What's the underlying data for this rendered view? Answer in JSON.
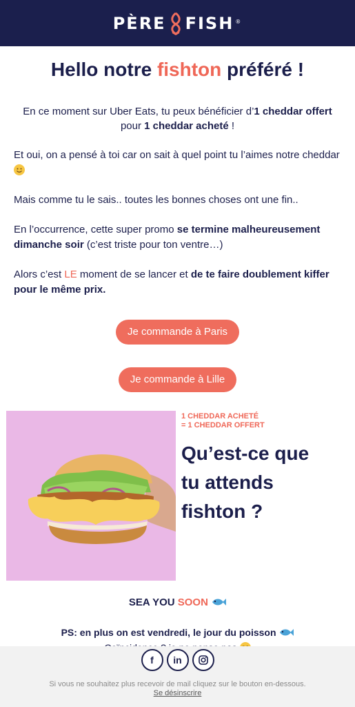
{
  "header": {
    "logo_left": "PÈRE",
    "logo_right": "FISH",
    "logo_mark": "®"
  },
  "title": {
    "before": "Hello notre ",
    "accent": "fishton",
    "after": " préféré !"
  },
  "intro": {
    "t1": "En ce moment sur Uber Eats, tu peux bénéficier d’",
    "b1": "1 cheddar offert",
    "t2": " pour ",
    "b2": "1 cheddar acheté",
    "t3": " !"
  },
  "p1": {
    "text": "Et oui, on a pensé à toi car on sait à quel point tu l’aimes notre cheddar",
    "emoji": "smiling-face-icon"
  },
  "p2": {
    "text": "Mais comme tu le sais.. toutes les bonnes choses ont une fin.."
  },
  "p3": {
    "t1": "En l’occurrence, cette super promo ",
    "b1": "se termine malheureusement dimanche soir",
    "t2": " (c’est triste pour ton ventre…)"
  },
  "p4": {
    "t1": "Alors c’est ",
    "red": "LE",
    "t2": " moment de se lancer et ",
    "b1": "de te faire doublement kiffer pour le même prix."
  },
  "buttons": {
    "paris": "Je commande à Paris",
    "lille": "Je commande à Lille"
  },
  "promo": {
    "deal_line1": "1 CHEDDAR ACHETÉ",
    "deal_line2": "= 1 CHEDDAR OFFERT",
    "headline": [
      "Qu’est-ce que",
      "tu attends",
      "fishton ?"
    ]
  },
  "sea": {
    "t1": "SEA YOU ",
    "red": "SOON"
  },
  "ps": {
    "b1": "PS: en plus on est vendredi, le jour du poisson",
    "t2": "Coïncidence ? je ne pense pas"
  },
  "footer": {
    "socials": [
      "facebook-icon",
      "linkedin-icon",
      "instagram-icon"
    ],
    "unsubscribe_text": "Si vous ne souhaitez plus recevoir de mail cliquez sur le bouton en-dessous.",
    "unsubscribe_link": "Se désinscrire"
  },
  "colors": {
    "navy": "#1b1f4d",
    "coral": "#ef6d5d",
    "pink_bg": "#eab8e6"
  }
}
